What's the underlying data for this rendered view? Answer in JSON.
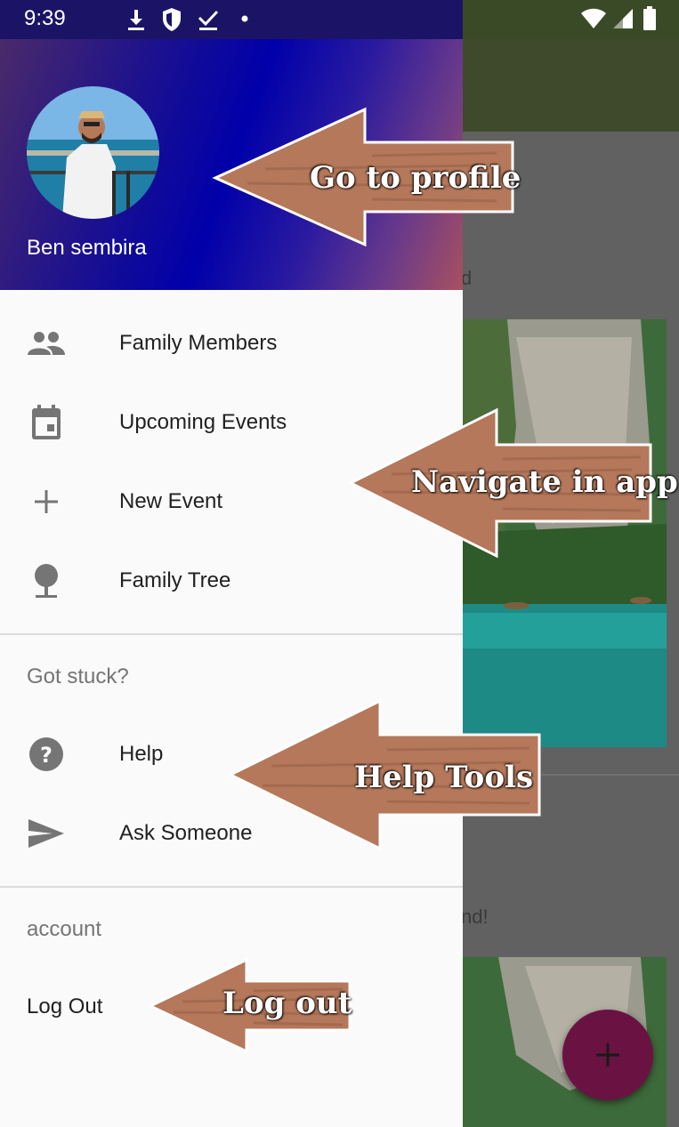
{
  "status_bar": {
    "time": "9:39"
  },
  "drawer": {
    "profile_name": "Ben sembira",
    "nav_items": [
      {
        "label": "Family Members",
        "icon": "people-icon"
      },
      {
        "label": "Upcoming Events",
        "icon": "calendar-icon"
      },
      {
        "label": "New Event",
        "icon": "plus-icon"
      },
      {
        "label": "Family Tree",
        "icon": "tree-icon"
      }
    ],
    "help_section": {
      "title": "Got stuck?",
      "items": [
        {
          "label": "Help",
          "icon": "help-circle-icon"
        },
        {
          "label": "Ask Someone",
          "icon": "send-icon"
        }
      ]
    },
    "account_section": {
      "title": "account",
      "logout_label": "Log Out"
    }
  },
  "background": {
    "partial_text_1": "d",
    "partial_text_2": "nd!"
  },
  "annotations": {
    "profile": "Go to profile",
    "navigate": "Navigate in app",
    "help": "Help Tools",
    "logout": "Log out"
  },
  "colors": {
    "accent_fab": "#6a1342",
    "arrow_fill": "#b5785a",
    "header_blue": "#0000aa"
  }
}
